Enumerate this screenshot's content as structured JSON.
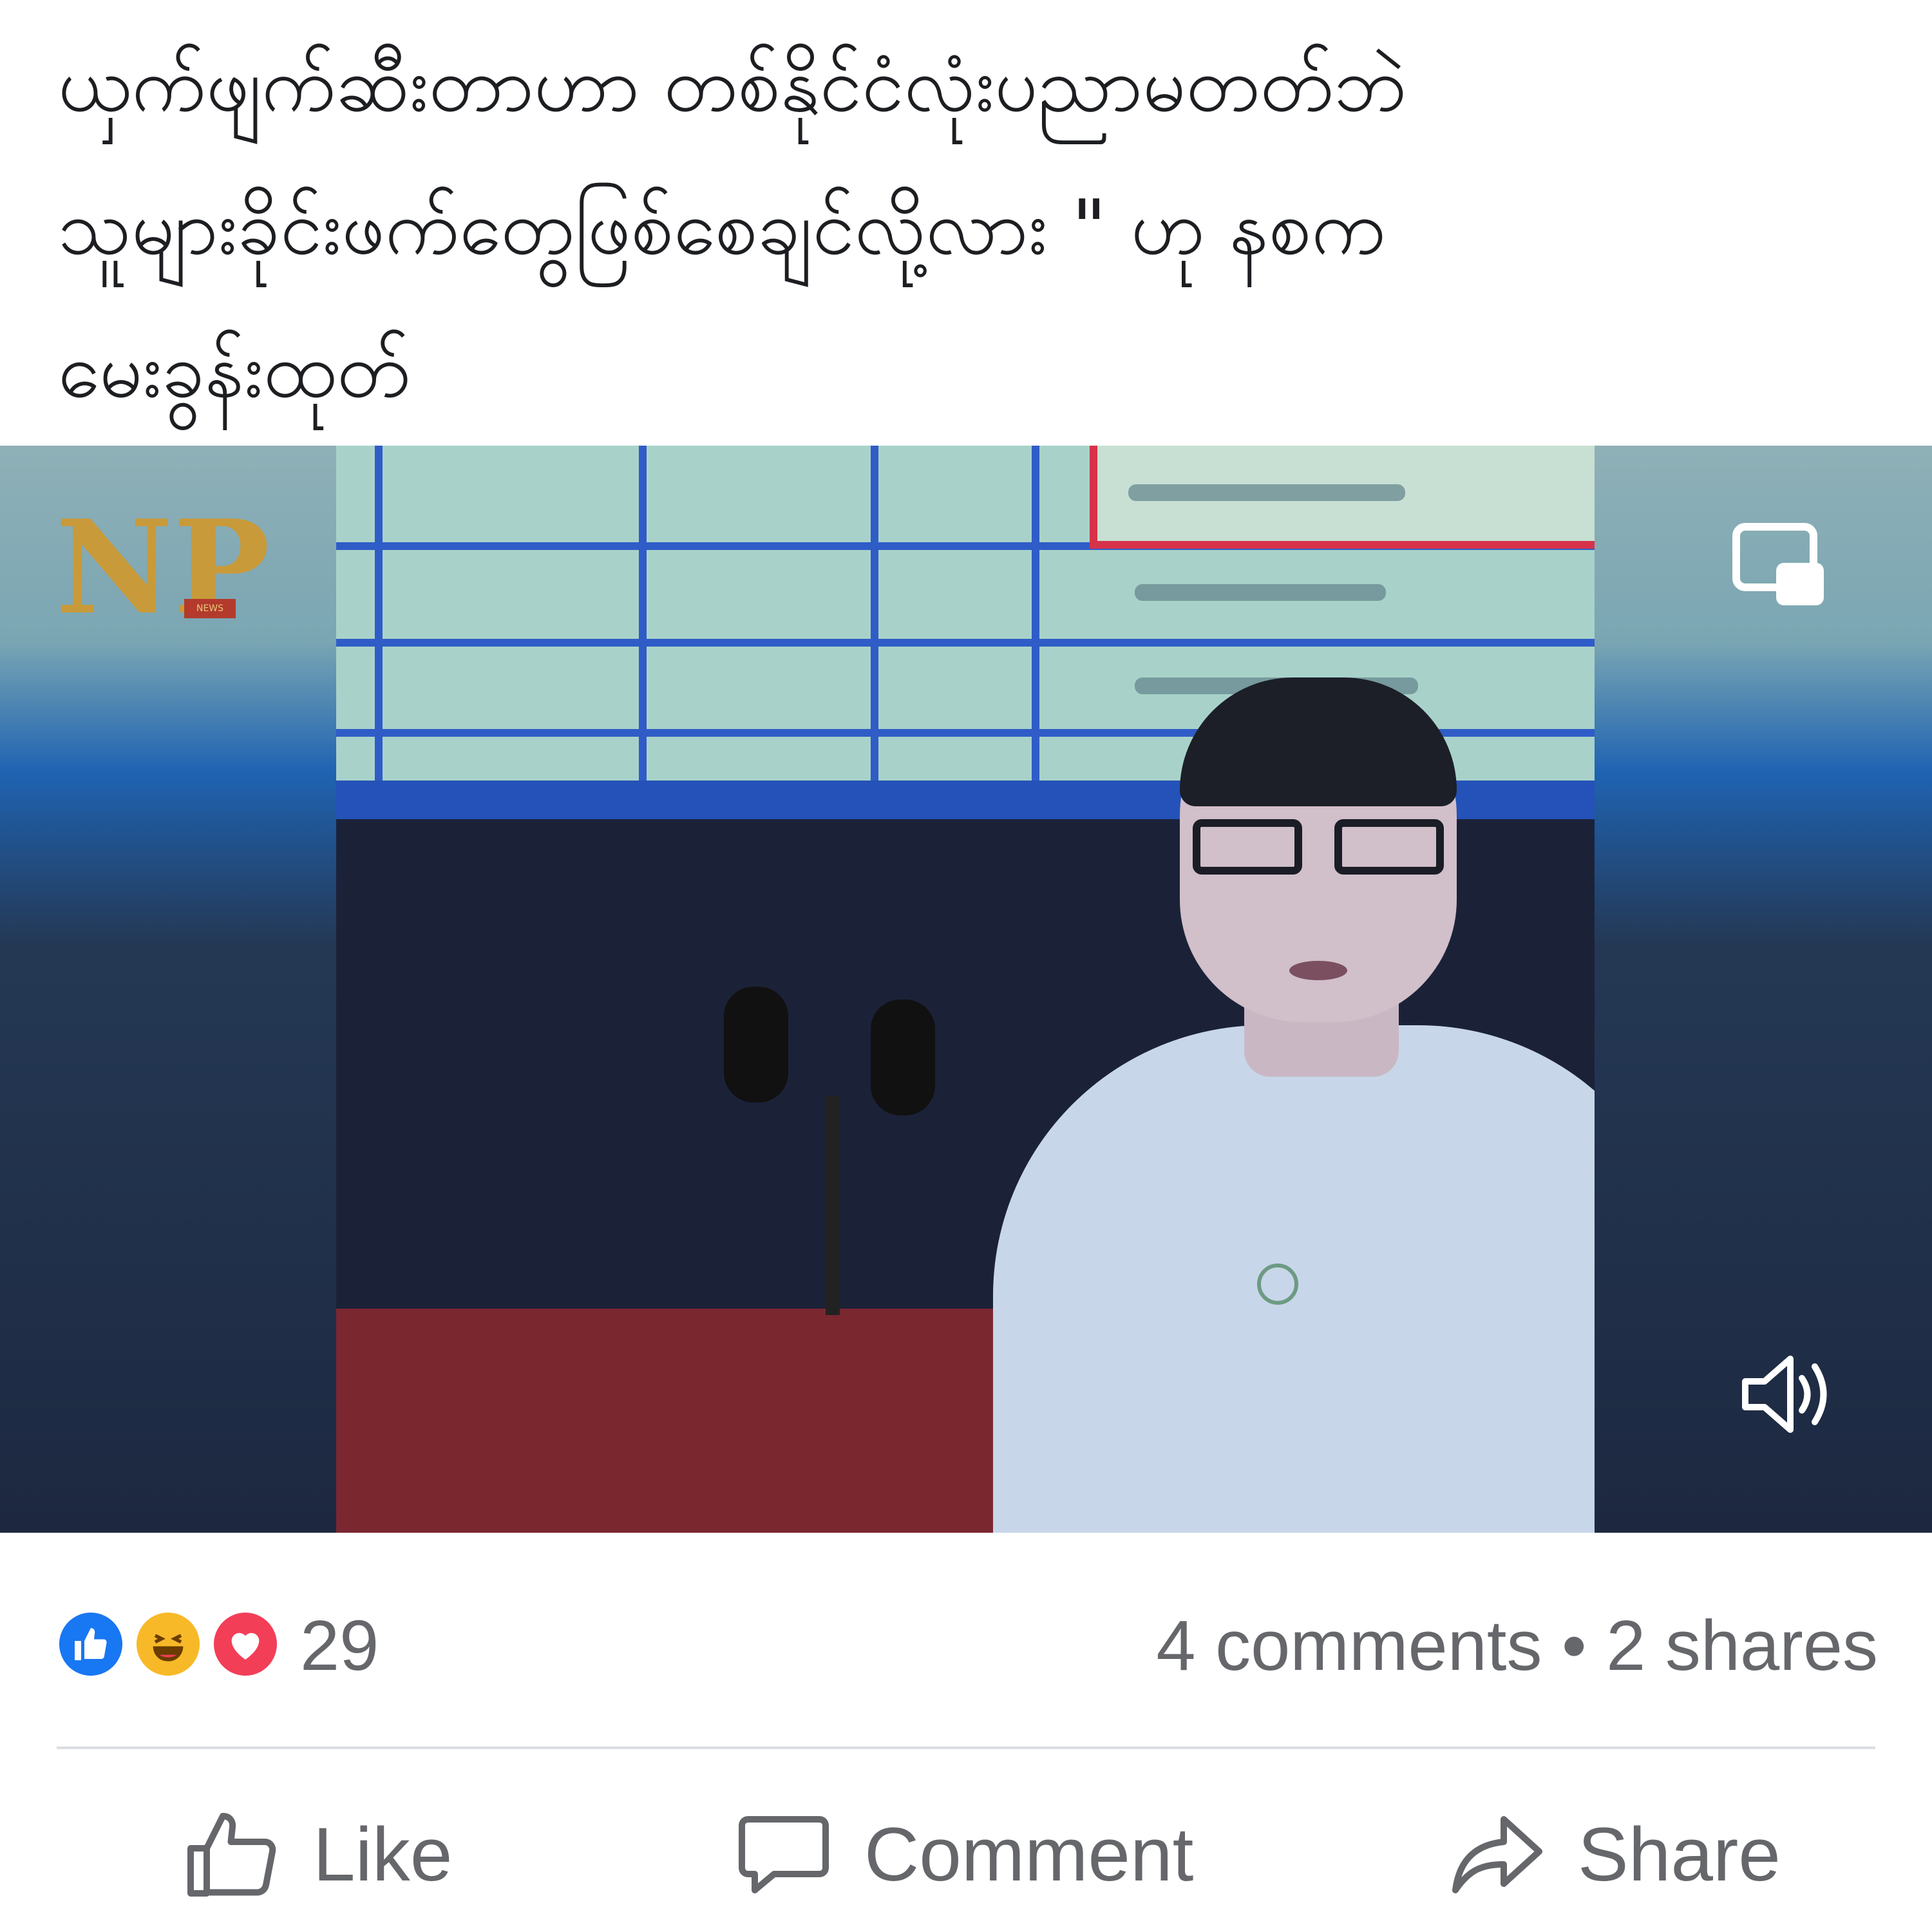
{
  "post": {
    "caption_lines": [
      "ယှက်ဖျက်ဆီးတာဟာ တစ်နိုင်ငံလုံးပညာမတတ်ဘဲ",
      "သူများခိုင်းဖက်တွေဖြစ်စေချင်လို့လား \" ဟု နစက",
      "မေးခွန်းထုတ်"
    ]
  },
  "video": {
    "logo_text": "NP",
    "logo_tag": "NEWS",
    "controls": {
      "pip": "picture-in-picture-icon",
      "volume": "volume-icon"
    },
    "colors": {
      "screen": "#a8d2c9",
      "grid": "#2f5cc7",
      "shirt": "#c8d6e9",
      "podium": "#7a2730"
    }
  },
  "stats": {
    "reaction_count": "29",
    "comments_shares": "4 comments • 2 shares",
    "reactions": [
      "like-reaction-icon",
      "haha-reaction-icon",
      "love-reaction-icon"
    ]
  },
  "actions": {
    "like": "Like",
    "comment": "Comment",
    "share": "Share"
  },
  "colors": {
    "text": "#1c1e21",
    "muted": "#65676b",
    "like_blue": "#1877f2",
    "haha_yellow": "#f7b928",
    "love_red": "#f33e58"
  }
}
